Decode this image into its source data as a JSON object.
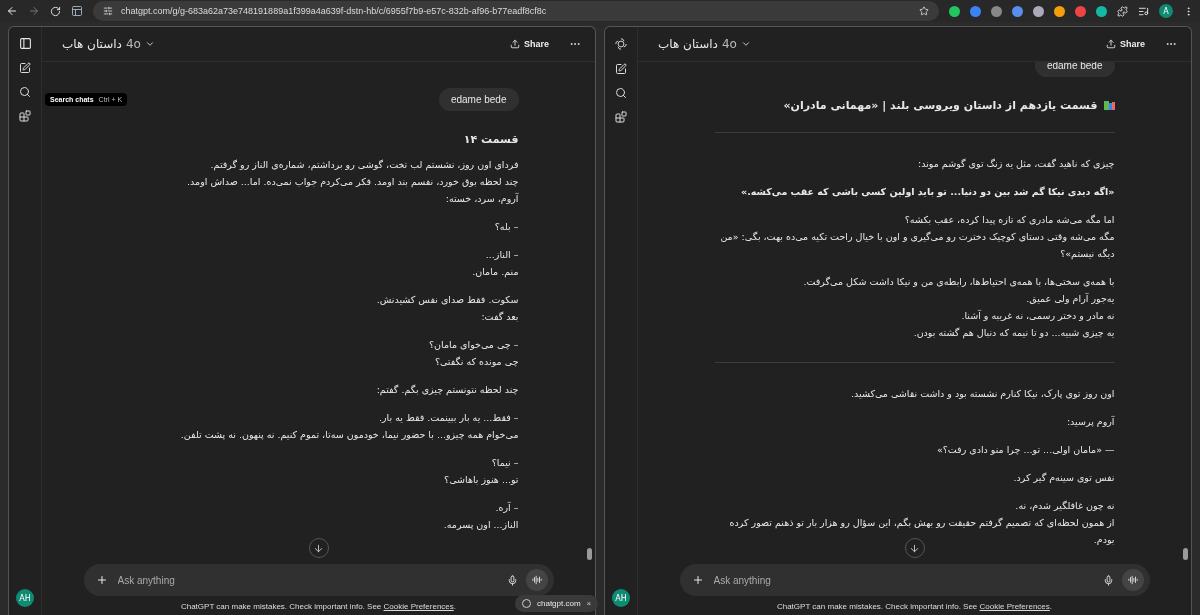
{
  "browser": {
    "url": "chatgpt.com/g/g-683a62a73e748191889a1f399a4a639f-dstn-hb/c/6955f7b9-e57c-832b-af96-b77eadf8cf8c",
    "profile_initial": "A"
  },
  "left_window": {
    "shows_logo": false,
    "title": "داستان هاب",
    "model": "4o",
    "share": "Share",
    "tooltip": {
      "label": "Search chats",
      "shortcut": "Ctrl + K"
    },
    "user_message": "edame bede",
    "avatar": "AH",
    "placeholder": "Ask anything",
    "footer": {
      "text": "ChatGPT can make mistakes. Check important info. See ",
      "link": "Cookie Preferences",
      "end": "."
    },
    "blocks": [
      {
        "kind": "heading",
        "text": "قسمت ۱۴"
      },
      {
        "kind": "paragraph",
        "lines": [
          "فردای اون روز، نشستم لب تخت، گوشی رو برداشتم، شماره‌ی الناز رو گرفتم.",
          "چند لحظه بوق خورد، نفسم بند اومد. فکر می‌کردم جواب نمی‌ده. اما... صداش اومد.",
          "آروم، سرد، خسته:"
        ]
      },
      {
        "kind": "paragraph",
        "lines": [
          "– بله؟"
        ]
      },
      {
        "kind": "paragraph",
        "lines": [
          "– الناز...",
          "منم. مامان."
        ]
      },
      {
        "kind": "paragraph",
        "lines": [
          "سکوت. فقط صدای نفس کشیدنش.",
          "بعد گفت:"
        ]
      },
      {
        "kind": "paragraph",
        "lines": [
          "– چی می‌خوای مامان؟",
          "چی مونده که نگفتی؟"
        ]
      },
      {
        "kind": "paragraph",
        "lines": [
          "چند لحظه نتونستم چیزی بگم. گفتم:"
        ]
      },
      {
        "kind": "paragraph",
        "lines": [
          "– فقط... یه بار ببینمت. فقط یه بار.",
          "می‌خوام همه چیزو... با حضور نیما، خودمون سه‌تا، تموم کنیم. نه پنهون. نه پشت تلفن."
        ]
      },
      {
        "kind": "paragraph",
        "lines": [
          "– نیما؟",
          "تو... هنوز باهاشی؟"
        ]
      },
      {
        "kind": "paragraph",
        "lines": [
          "– آره.",
          "الناز... اون پسرمه."
        ]
      }
    ]
  },
  "right_window": {
    "shows_logo": true,
    "title": "داستان هاب",
    "model": "4o",
    "share": "Share",
    "user_message": "edame bede",
    "avatar": "AH",
    "placeholder": "Ask anything",
    "footer": {
      "text": "ChatGPT can make mistakes. Check important info. See ",
      "link": "Cookie Preferences",
      "end": "."
    },
    "blocks": [
      {
        "kind": "heading",
        "books_icon": true,
        "text": "قسمت یازدهم از داستان ویروسی بلند | «مهمانی مادران»"
      },
      {
        "kind": "divider"
      },
      {
        "kind": "paragraph",
        "lines": [
          "چیزی که ناهید گفت، مثل یه زنگ توی گوشم موند:"
        ]
      },
      {
        "kind": "quote",
        "lines": [
          "«اگه دیدی نیکا گم شد بین دو دنیا... تو باید اولین کسی باشی که عقب می‌کشه.»"
        ]
      },
      {
        "kind": "paragraph",
        "lines": [
          "اما مگه می‌شه مادری که تازه پیدا کرده، عقب بکشه؟",
          "مگه می‌شه وقتی دستای کوچیک دخترت رو می‌گیری و اون با خیال راحت تکیه می‌ده بهت، بگی: «من دیگه نیستم»؟"
        ]
      },
      {
        "kind": "paragraph",
        "lines": [
          "با همه‌ی سختی‌ها، با همه‌ی احتیاط‌ها، رابطه‌ی من و نیکا داشت شکل می‌گرفت.",
          "یه‌جور آرام ولی عمیق.",
          "نه مادر و دختر رسمی، نه غریبه و آشنا.",
          "یه چیزی شبیه... دو تا نیمه که دنبال هم گشته بودن."
        ]
      },
      {
        "kind": "divider"
      },
      {
        "kind": "paragraph",
        "lines": [
          "اون روز توی پارک، نیکا کنارم نشسته بود و داشت نقاشی می‌کشید."
        ]
      },
      {
        "kind": "paragraph",
        "lines": [
          "آروم پرسید:"
        ]
      },
      {
        "kind": "paragraph",
        "lines": [
          "— «مامان اولی... تو... چرا منو دادی رفت؟»"
        ]
      },
      {
        "kind": "paragraph",
        "lines": [
          "نفس توی سینه‌م گیر کرد."
        ]
      },
      {
        "kind": "paragraph",
        "lines": [
          "نه چون غافلگیر شدم، نه.",
          "از همون لحظه‌ای که تصمیم گرفتم حقیقت رو بهش بگم، این سؤال رو هزار بار تو ذهنم تصور کرده بودم."
        ]
      }
    ]
  },
  "bottom_tab": {
    "label": "chatgpt.com",
    "close": "×"
  }
}
